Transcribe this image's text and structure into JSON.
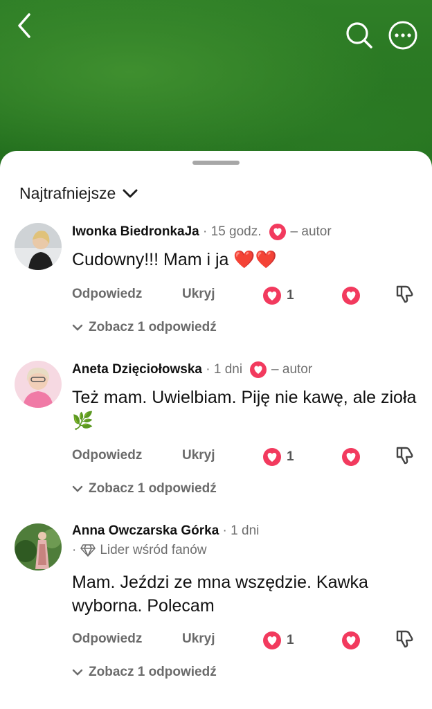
{
  "header": {
    "back_icon": "chevron-left-icon",
    "search_icon": "search-icon",
    "more_icon": "more-horizontal-icon"
  },
  "sort": {
    "label": "Najtrafniejsze"
  },
  "comments": [
    {
      "author": "Iwonka BiedronkaJa",
      "time": "15 godz.",
      "author_tag": "– autor",
      "text": "Cudowny!!! Mam i ja ❤️❤️",
      "reply_label": "Odpowiedz",
      "hide_label": "Ukryj",
      "likes": "1",
      "replies_label": "Zobacz 1 odpowiedź"
    },
    {
      "author": "Aneta Dzięciołowska",
      "time": "1 dni",
      "author_tag": "– autor",
      "text": "Też mam. Uwielbiam. Piję nie kawę, ale zioła 🌿",
      "reply_label": "Odpowiedz",
      "hide_label": "Ukryj",
      "likes": "1",
      "replies_label": "Zobacz 1 odpowiedź"
    },
    {
      "author": "Anna Owczarska Górka",
      "time": "1 dni",
      "fan_badge": "Lider wśród fanów",
      "text": "Mam. Jeździ ze mna wszędzie. Kawka wyborna. Polecam",
      "reply_label": "Odpowiedz",
      "hide_label": "Ukryj",
      "likes": "1",
      "replies_label": "Zobacz 1 odpowiedź"
    }
  ],
  "colors": {
    "accent_red": "#f23a5e",
    "background_green": "#2a7a22",
    "muted_text": "#6b6b6b"
  }
}
